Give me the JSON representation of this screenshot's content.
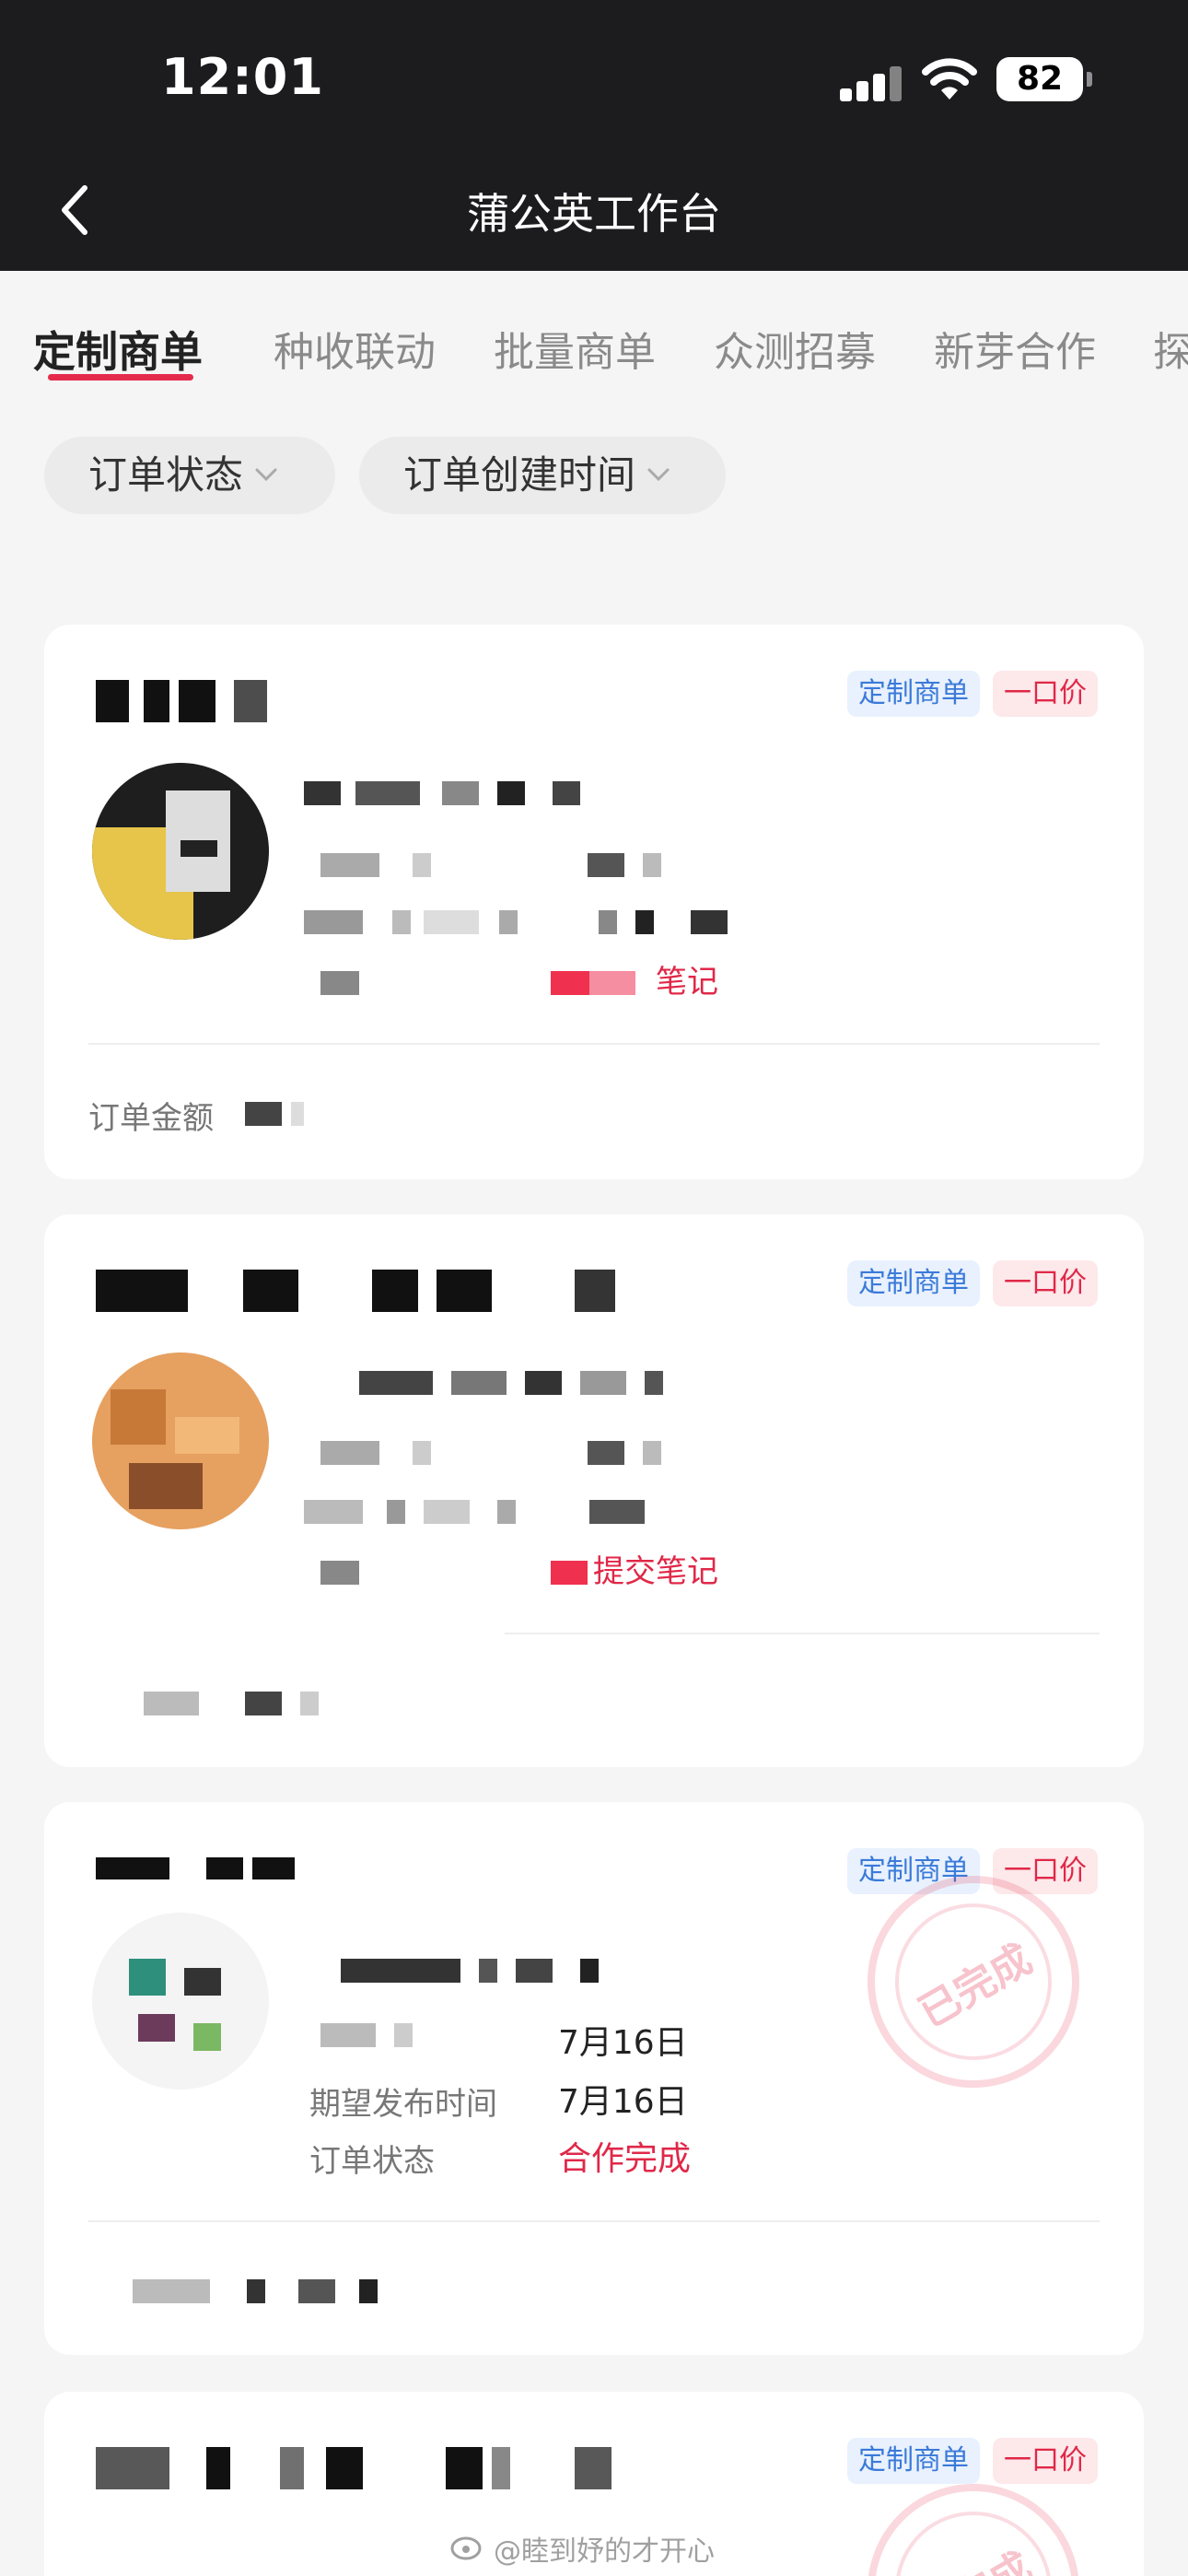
{
  "status_bar": {
    "time": "12:01",
    "battery": "82"
  },
  "nav": {
    "title": "蒲公英工作台"
  },
  "tabs": [
    {
      "label": "定制商单",
      "active": true
    },
    {
      "label": "种收联动"
    },
    {
      "label": "批量商单"
    },
    {
      "label": "众测招募"
    },
    {
      "label": "新芽合作"
    },
    {
      "label": "探"
    }
  ],
  "filters": [
    {
      "label": "订单状态"
    },
    {
      "label": "订单创建时间"
    }
  ],
  "tags": {
    "custom": "定制商单",
    "fixed": "一口价"
  },
  "cards": [
    {
      "note": "笔记",
      "amount_label": "订单金额"
    },
    {
      "note": "提交笔记"
    },
    {
      "publish_date": "7月16日",
      "expect_label": "期望发布时间",
      "expect_value": "7月16日",
      "status_label": "订单状态",
      "status_value": "合作完成",
      "stamp": "已完成"
    },
    {
      "stamp": "已完成"
    }
  ],
  "watermark": "@睦到妤的才开心",
  "colors": {
    "accent": "#e52b4c",
    "tag_blue": "#3b7ad9",
    "dark_header": "#1c1c1e"
  }
}
